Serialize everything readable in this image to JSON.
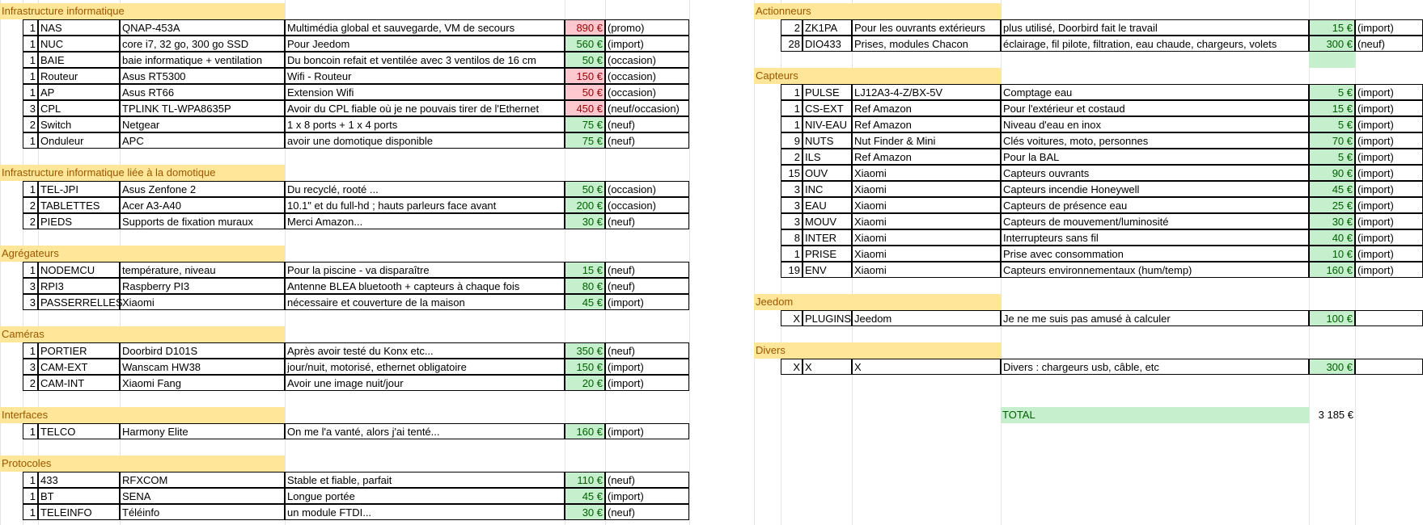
{
  "colors": {
    "section_header_bg": "#ffe699",
    "section_header_text": "#9c5700",
    "price_good_bg": "#c6efce",
    "price_good_text": "#006100",
    "price_bad_bg": "#ffc7ce",
    "price_bad_text": "#9c0006"
  },
  "left_sections": [
    {
      "title": "Infrastructure informatique",
      "rows": [
        {
          "qty": "1",
          "code": "NAS",
          "model": "QNAP-453A",
          "desc": "Multimédia global et sauvegarde, VM de secours",
          "price": "890 €",
          "status": "red",
          "note": "(promo)"
        },
        {
          "qty": "1",
          "code": "NUC",
          "model": "core i7, 32 go, 300 go SSD",
          "desc": "Pour Jeedom",
          "price": "560 €",
          "status": "green",
          "note": "(import)"
        },
        {
          "qty": "1",
          "code": "BAIE",
          "model": "baie informatique + ventilation",
          "desc": "Du boncoin refait et ventilée avec 3 ventilos de 16 cm",
          "price": "50 €",
          "status": "green",
          "note": "(occasion)"
        },
        {
          "qty": "1",
          "code": "Routeur",
          "model": "Asus RT5300",
          "desc": "Wifi - Routeur",
          "price": "150 €",
          "status": "red",
          "note": "(occasion)"
        },
        {
          "qty": "1",
          "code": "AP",
          "model": "Asus RT66",
          "desc": "Extension Wifi",
          "price": "50 €",
          "status": "red",
          "note": "(occasion)"
        },
        {
          "qty": "3",
          "code": "CPL",
          "model": "TPLINK TL-WPA8635P",
          "desc": "Avoir du CPL fiable où je ne pouvais tirer de l'Ethernet",
          "price": "450 €",
          "status": "red",
          "note": "(neuf/occasion)"
        },
        {
          "qty": "2",
          "code": "Switch",
          "model": "Netgear",
          "desc": "1 x 8 ports + 1 x 4 ports",
          "price": "75 €",
          "status": "green",
          "note": "(neuf)"
        },
        {
          "qty": "1",
          "code": "Onduleur",
          "model": "APC",
          "desc": "avoir une domotique disponible",
          "price": "75 €",
          "status": "green",
          "note": "(neuf)"
        }
      ]
    },
    {
      "title": "Infrastructure informatique liée à la domotique",
      "rows": [
        {
          "qty": "1",
          "code": "TEL-JPI",
          "model": "Asus Zenfone 2",
          "desc": "Du recyclé, rooté ...",
          "price": "50 €",
          "status": "green",
          "note": "(occasion)"
        },
        {
          "qty": "2",
          "code": "TABLETTES",
          "model": "Acer A3-A40",
          "desc": "10.1\" et du full-hd ; hauts parleurs face avant",
          "price": "200 €",
          "status": "green",
          "note": "(occasion)"
        },
        {
          "qty": "2",
          "code": "PIEDS",
          "model": "Supports de fixation muraux",
          "desc": "Merci Amazon...",
          "price": "30 €",
          "status": "green",
          "note": "(neuf)"
        }
      ]
    },
    {
      "title": "Agrégateurs",
      "rows": [
        {
          "qty": "1",
          "code": "NODEMCU",
          "model": "température, niveau",
          "desc": "Pour la piscine - va disparaître",
          "price": "15 €",
          "status": "green",
          "note": "(neuf)"
        },
        {
          "qty": "3",
          "code": "RPI3",
          "model": "Raspberry PI3",
          "desc": "Antenne BLEA bluetooth + capteurs à chaque fois",
          "price": "80 €",
          "status": "green",
          "note": "(neuf)"
        },
        {
          "qty": "3",
          "code": "PASSERRELLES",
          "model": "Xiaomi",
          "desc": "nécessaire et couverture de la maison",
          "price": "45 €",
          "status": "green",
          "note": "(import)"
        }
      ]
    },
    {
      "title": "Caméras",
      "rows": [
        {
          "qty": "1",
          "code": "PORTIER",
          "model": "Doorbird D101S",
          "desc": "Après avoir testé du Konx etc...",
          "price": "350 €",
          "status": "green",
          "note": "(neuf)"
        },
        {
          "qty": "3",
          "code": "CAM-EXT",
          "model": "Wanscam HW38",
          "desc": "jour/nuit, motorisé, ethernet obligatoire",
          "price": "150 €",
          "status": "green",
          "note": "(import)"
        },
        {
          "qty": "2",
          "code": "CAM-INT",
          "model": "Xiaomi Fang",
          "desc": "Avoir une image nuit/jour",
          "price": "20 €",
          "status": "green",
          "note": "(import)"
        }
      ]
    },
    {
      "title": "Interfaces",
      "rows": [
        {
          "qty": "1",
          "code": "TELCO",
          "model": "Harmony Elite",
          "desc": "On me l'a vanté, alors j'ai tenté...",
          "price": "160 €",
          "status": "green",
          "note": "(import)"
        }
      ]
    },
    {
      "title": "Protocoles",
      "rows": [
        {
          "qty": "1",
          "code": "433",
          "model": "RFXCOM",
          "desc": "Stable et fiable, parfait",
          "price": "110 €",
          "status": "green",
          "note": "(neuf)"
        },
        {
          "qty": "1",
          "code": "BT",
          "model": "SENA",
          "desc": "Longue portée",
          "price": "45 €",
          "status": "green",
          "note": "(import)"
        },
        {
          "qty": "1",
          "code": "TELEINFO",
          "model": "Téléinfo",
          "desc": "un module FTDI...",
          "price": "30 €",
          "status": "green",
          "note": "(neuf)"
        }
      ]
    }
  ],
  "right_sections": [
    {
      "title": "Actionneurs",
      "rows": [
        {
          "qty": "2",
          "code": "ZK1PA",
          "model": "Pour les ouvrants extérieurs",
          "desc": "plus utilisé, Doorbird fait le travail",
          "price": "15 €",
          "status": "green",
          "note": "(import)"
        },
        {
          "qty": "28",
          "code": "DIO433",
          "model": "Prises, modules Chacon",
          "desc": "éclairage, fil pilote, filtration, eau chaude, chargeurs, volets",
          "price": "300 €",
          "status": "green",
          "note": "(neuf)"
        }
      ]
    },
    {
      "title": "Capteurs",
      "rows": [
        {
          "qty": "1",
          "code": "PULSE",
          "model": "LJ12A3-4-Z/BX-5V",
          "desc": "Comptage eau",
          "price": "5 €",
          "status": "green",
          "note": "(import)"
        },
        {
          "qty": "1",
          "code": "CS-EXT",
          "model": "Ref Amazon",
          "desc": "Pour l'extérieur et costaud",
          "price": "15 €",
          "status": "green",
          "note": "(import)"
        },
        {
          "qty": "1",
          "code": "NIV-EAU",
          "model": "Ref Amazon",
          "desc": "Niveau d'eau en inox",
          "price": "5 €",
          "status": "green",
          "note": "(import)"
        },
        {
          "qty": "9",
          "code": "NUTS",
          "model": "Nut Finder & Mini",
          "desc": "Clés voitures, moto, personnes",
          "price": "70 €",
          "status": "green",
          "note": "(import)"
        },
        {
          "qty": "2",
          "code": "ILS",
          "model": "Ref Amazon",
          "desc": "Pour la BAL",
          "price": "5 €",
          "status": "green",
          "note": "(import)"
        },
        {
          "qty": "15",
          "code": "OUV",
          "model": "Xiaomi",
          "desc": "Capteurs ouvrants",
          "price": "90 €",
          "status": "green",
          "note": "(import)"
        },
        {
          "qty": "3",
          "code": "INC",
          "model": "Xiaomi",
          "desc": "Capteurs incendie Honeywell",
          "price": "45 €",
          "status": "green",
          "note": "(import)"
        },
        {
          "qty": "3",
          "code": "EAU",
          "model": "Xiaomi",
          "desc": "Capteurs de présence eau",
          "price": "25 €",
          "status": "green",
          "note": "(import)"
        },
        {
          "qty": "3",
          "code": "MOUV",
          "model": "Xiaomi",
          "desc": "Capteurs de mouvement/luminosité",
          "price": "30 €",
          "status": "green",
          "note": "(import)"
        },
        {
          "qty": "8",
          "code": "INTER",
          "model": "Xiaomi",
          "desc": "Interrupteurs sans fil",
          "price": "40 €",
          "status": "green",
          "note": "(import)"
        },
        {
          "qty": "1",
          "code": "PRISE",
          "model": "Xiaomi",
          "desc": "Prise avec consommation",
          "price": "10 €",
          "status": "green",
          "note": "(import)"
        },
        {
          "qty": "19",
          "code": "ENV",
          "model": "Xiaomi",
          "desc": "Capteurs environnementaux (hum/temp)",
          "price": "160 €",
          "status": "green",
          "note": "(import)"
        }
      ]
    },
    {
      "title": "Jeedom",
      "rows": [
        {
          "qty": "X",
          "code": "PLUGINS",
          "model": "Jeedom",
          "desc": "Je ne me suis pas amusé à calculer",
          "price": "100 €",
          "status": "green",
          "note": ""
        }
      ]
    },
    {
      "title": "Divers",
      "rows": [
        {
          "qty": "X",
          "code": "X",
          "model": "X",
          "desc": "Divers : chargeurs usb, câble, etc",
          "price": "300 €",
          "status": "green",
          "note": ""
        }
      ]
    }
  ],
  "total": {
    "label": "TOTAL",
    "value": "3 185 €"
  }
}
